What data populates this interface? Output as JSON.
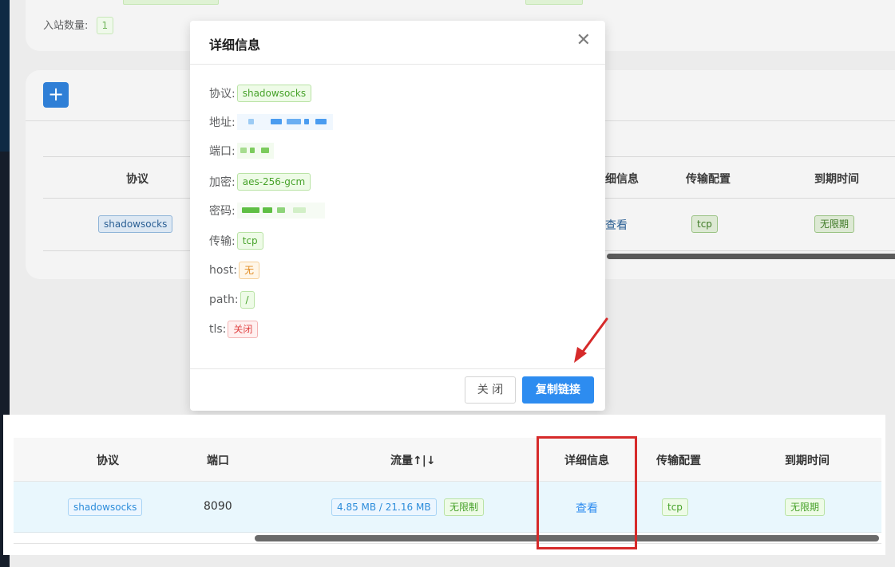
{
  "background": {
    "inbound_count_label": "入站数量:",
    "inbound_count_value": "1",
    "table_headers": [
      "协议",
      "细信息",
      "传输配置",
      "到期时间"
    ],
    "row": {
      "protocol": "shadowsocks",
      "details": "查看",
      "transport": "tcp",
      "expiry": "无限期"
    }
  },
  "modal": {
    "title": "详细信息",
    "close_icon": "close-icon",
    "fields": {
      "protocol_label": "协议:",
      "protocol_value": "shadowsocks",
      "address_label": "地址:",
      "port_label": "端口:",
      "encryption_label": "加密:",
      "encryption_value": "aes-256-gcm",
      "password_label": "密码:",
      "transport_label": "传输:",
      "transport_value": "tcp",
      "host_label": "host:",
      "host_value": "无",
      "path_label": "path:",
      "path_value": "/",
      "tls_label": "tls:",
      "tls_value": "关闭"
    },
    "close_button": "关 闭",
    "copy_button": "复制链接"
  },
  "lower_table": {
    "headers": [
      "协议",
      "端口",
      "流量↑|↓",
      "详细信息",
      "传输配置",
      "到期时间"
    ],
    "row": {
      "protocol": "shadowsocks",
      "port": "8090",
      "traffic": "4.85 MB / 21.16 MB",
      "traffic_limit": "无限制",
      "details": "查看",
      "transport": "tcp",
      "expiry": "无限期"
    }
  },
  "colors": {
    "accent": "#2d8cf0",
    "highlight": "#d62a2a",
    "success": "#47a22a"
  }
}
